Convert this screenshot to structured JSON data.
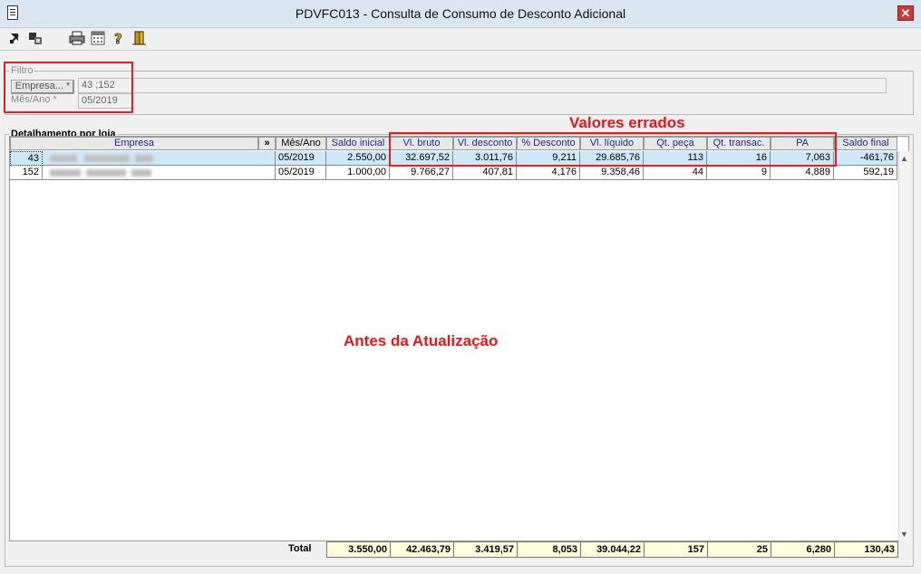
{
  "window": {
    "title": "PDVFC013 - Consulta de Consumo de Desconto Adicional",
    "close_symbol": "✕"
  },
  "toolbar": {
    "icons": [
      "enter-icon",
      "navigate-icon",
      "print-icon",
      "calculator-icon",
      "help-icon",
      "exit-door-icon"
    ]
  },
  "filter": {
    "legend": "Filtro",
    "empresa_button": "Empresa... *",
    "empresa_value": "43 ;152",
    "mes_label": "Mês/Ano *",
    "mes_value": "05/2019"
  },
  "detail": {
    "legend": "Detalhamento por loja",
    "expand_symbol": "»",
    "columns": [
      "Empresa",
      "Mês/Ano",
      "Saldo inicial",
      "Vl. bruto",
      "Vl. desconto",
      "% Desconto",
      "Vl. líquido",
      "Qt. peça",
      "Qt. transac.",
      "PA",
      "Saldo final"
    ],
    "rows": [
      {
        "empresa": "43",
        "mes": "05/2019",
        "saldo_inicial": "2.550,00",
        "vl_bruto": "32.697,52",
        "vl_desconto": "3.011,76",
        "pct_desconto": "9,211",
        "vl_liquido": "29.685,76",
        "qt_peca": "113",
        "qt_transac": "16",
        "pa": "7,063",
        "saldo_final": "-461,76"
      },
      {
        "empresa": "152",
        "mes": "05/2019",
        "saldo_inicial": "1.000,00",
        "vl_bruto": "9.766,27",
        "vl_desconto": "407,81",
        "pct_desconto": "4,176",
        "vl_liquido": "9.358,46",
        "qt_peca": "44",
        "qt_transac": "9",
        "pa": "4,889",
        "saldo_final": "592,19"
      }
    ],
    "total_label": "Total",
    "totals": {
      "saldo_inicial": "3.550,00",
      "vl_bruto": "42.463,79",
      "vl_desconto": "3.419,57",
      "pct_desconto": "8,053",
      "vl_liquido": "39.044,22",
      "qt_peca": "157",
      "qt_transac": "25",
      "pa": "6,280",
      "saldo_final": "130,43"
    }
  },
  "annotations": {
    "wrong_values": "Valores errados",
    "before_update": "Antes da Atualização"
  },
  "colors": {
    "annotation_red": "#e01818",
    "selected_row": "#cde8f8",
    "totals_bg": "#ffffdd",
    "header_text": "#1c2a8a"
  }
}
